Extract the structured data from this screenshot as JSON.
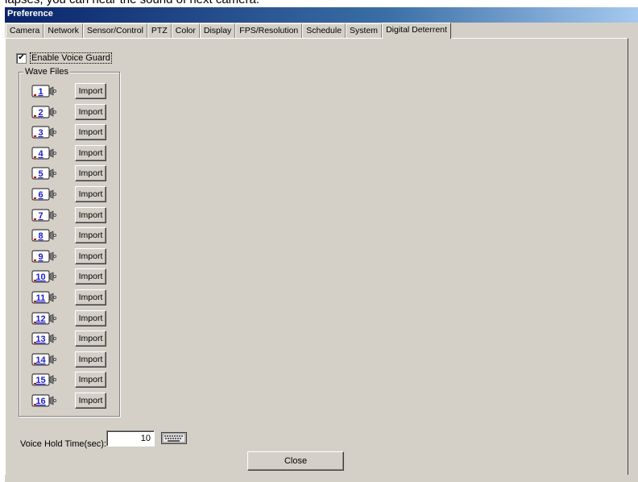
{
  "caption": "lapses, you can hear the sound of next camera.",
  "window": {
    "title": "Preference"
  },
  "tabs": [
    {
      "label": "Camera"
    },
    {
      "label": "Network"
    },
    {
      "label": "Sensor/Control"
    },
    {
      "label": "PTZ"
    },
    {
      "label": "Color"
    },
    {
      "label": "Display"
    },
    {
      "label": "FPS/Resolution"
    },
    {
      "label": "Schedule"
    },
    {
      "label": "System"
    },
    {
      "label": "Digital Deterrent",
      "active": true
    }
  ],
  "voice_guard": {
    "label": "Enable Voice Guard",
    "checked": true,
    "check_glyph": "✔"
  },
  "wave_files": {
    "title": "Wave Files",
    "import_label": "Import",
    "cameras": [
      "1",
      "2",
      "3",
      "4",
      "5",
      "6",
      "7",
      "8",
      "9",
      "10",
      "11",
      "12",
      "13",
      "14",
      "15",
      "16"
    ]
  },
  "voice_hold": {
    "label": "Voice Hold Time(sec):",
    "value": "10"
  },
  "close_label": "Close",
  "icons": {
    "camera": "camera-number-icon",
    "keyboard": "keyboard-icon"
  },
  "colors": {
    "title_start": "#0a246a",
    "title_end": "#a6caf0",
    "camera_number": "#1a1ad0"
  }
}
